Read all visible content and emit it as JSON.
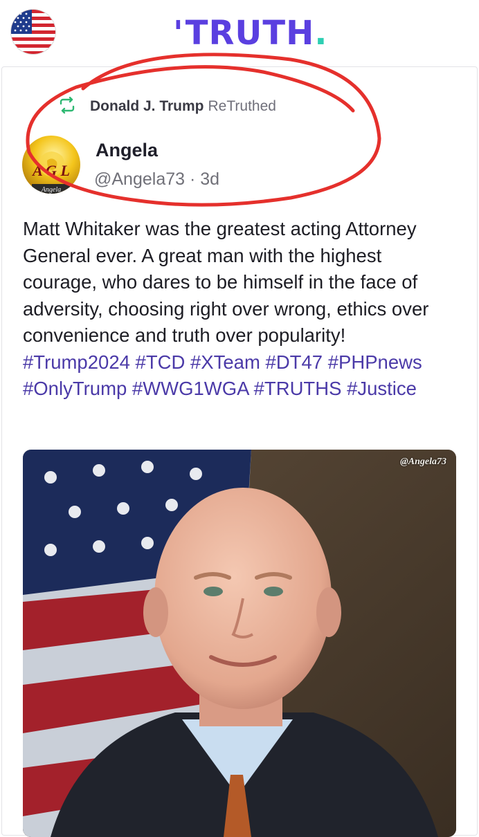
{
  "header": {
    "logo_text": "TRUTH",
    "logo_dot": ".",
    "flag_icon": "us-flag-icon"
  },
  "post": {
    "retruth_icon": "retruth-icon",
    "retruthed_by": "Donald J. Trump",
    "retruth_action": "ReTruthed",
    "author": {
      "display_name": "Angela",
      "handle": "@Angela73",
      "separator": "·",
      "time_ago": "3d",
      "avatar_letters": "A G L",
      "avatar_caption": "Angela"
    },
    "text": "Matt Whitaker was the greatest acting Attorney General ever. A great man with the highest courage, who dares to be himself in the face of adversity, choosing right over wrong, ethics over convenience and truth over popularity! ",
    "hashtags": [
      "#Trump2024",
      "#TCD",
      "#XTeam",
      "#DT47",
      "#PHPnews",
      "#OnlyTrump",
      "#WWG1WGA",
      "#TRUTHS",
      "#Justice"
    ],
    "media": {
      "watermark": "@Angela73"
    }
  },
  "colors": {
    "brand": "#5a3fe0",
    "brand_dot": "#2ecfb3",
    "hashtag": "#4b3aa8",
    "retruth_green": "#2eb872",
    "annotation_red": "#e5302c"
  }
}
